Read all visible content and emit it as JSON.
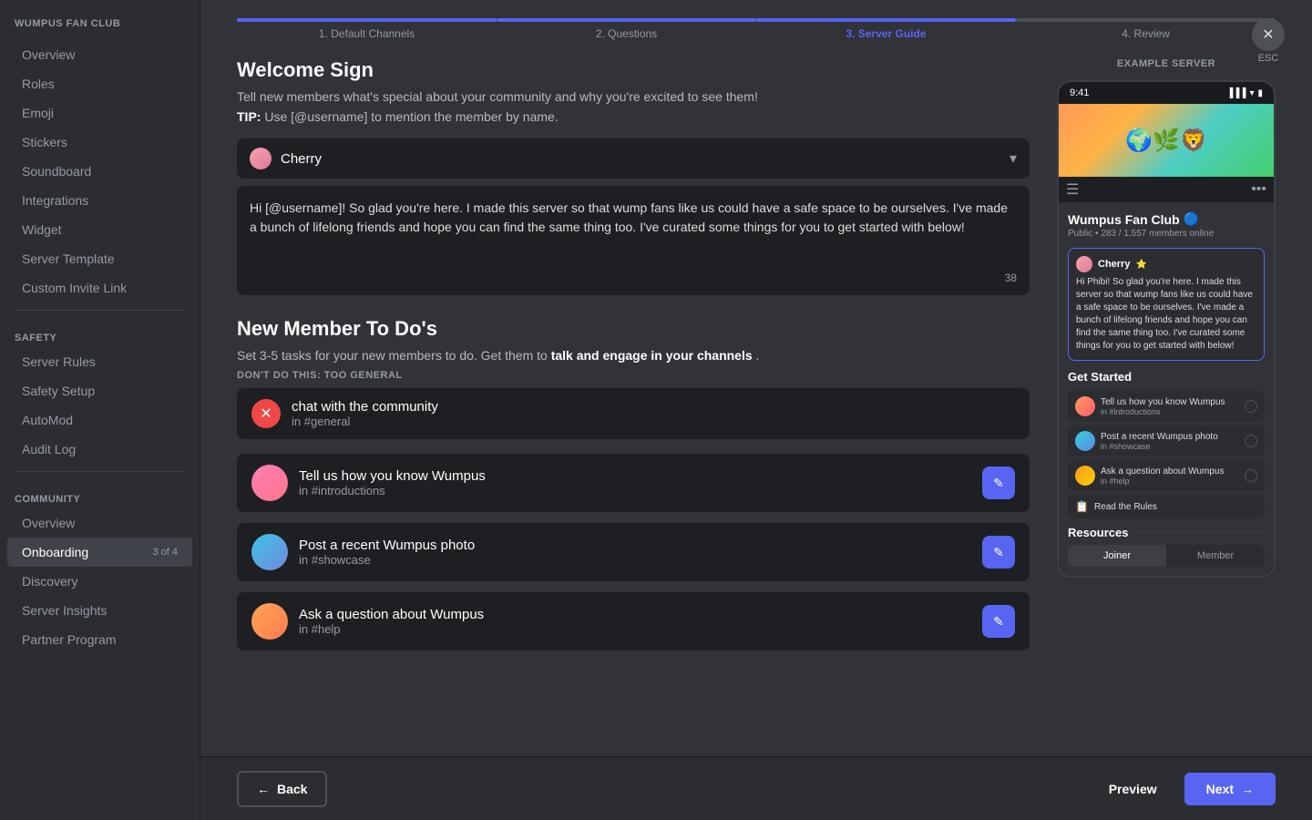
{
  "sidebar": {
    "server_name": "WUMPUS FAN CLUB",
    "items_main": [
      {
        "label": "Overview",
        "id": "overview"
      },
      {
        "label": "Roles",
        "id": "roles"
      },
      {
        "label": "Emoji",
        "id": "emoji"
      },
      {
        "label": "Stickers",
        "id": "stickers"
      },
      {
        "label": "Soundboard",
        "id": "soundboard"
      },
      {
        "label": "Integrations",
        "id": "integrations"
      },
      {
        "label": "Widget",
        "id": "widget"
      },
      {
        "label": "Server Template",
        "id": "server-template"
      },
      {
        "label": "Custom Invite Link",
        "id": "custom-invite"
      }
    ],
    "section_safety": "SAFETY",
    "items_safety": [
      {
        "label": "Server Rules",
        "id": "server-rules"
      },
      {
        "label": "Safety Setup",
        "id": "safety-setup"
      },
      {
        "label": "AutoMod",
        "id": "automod"
      },
      {
        "label": "Audit Log",
        "id": "audit-log"
      }
    ],
    "section_community": "COMMUNITY",
    "items_community": [
      {
        "label": "Overview",
        "id": "community-overview"
      },
      {
        "label": "Onboarding",
        "id": "onboarding",
        "badge": "3 of 4",
        "active": true
      },
      {
        "label": "Discovery",
        "id": "discovery"
      },
      {
        "label": "Server Insights",
        "id": "server-insights"
      },
      {
        "label": "Partner Program",
        "id": "partner-program"
      }
    ]
  },
  "stepper": {
    "steps": [
      {
        "label": "1. Default Channels",
        "state": "completed"
      },
      {
        "label": "2. Questions",
        "state": "completed"
      },
      {
        "label": "3. Server Guide",
        "state": "active"
      },
      {
        "label": "4. Review",
        "state": "inactive"
      }
    ],
    "esc_label": "ESC"
  },
  "welcome_sign": {
    "title": "Welcome Sign",
    "description": "Tell new members what's special about your community and why you're excited to see them!",
    "tip_label": "TIP:",
    "tip_text": "Use [@username] to mention the member by name.",
    "dropdown_name": "Cherry",
    "message_text": "Hi [@username]! So glad you're here. I made this server so that wump fans like us could have a safe space to be ourselves. I've made a bunch of lifelong friends and hope you can find the same thing too. I've curated some things for you to get started with below!",
    "message_count": "38"
  },
  "new_member_todos": {
    "title": "New Member To Do's",
    "description_normal": "Set 3-5 tasks for your new members to do. Get them to ",
    "description_bold": "talk and engage in your channels",
    "description_end": ".",
    "dont_label": "DON'T DO THIS: TOO GENERAL",
    "bad_item": {
      "text": "chat with the community",
      "channel": "in #general"
    },
    "good_items": [
      {
        "text": "Tell us how you know Wumpus",
        "channel": "in #introductions"
      },
      {
        "text": "Post a recent Wumpus photo",
        "channel": "in #showcase"
      },
      {
        "text": "Ask a question about Wumpus",
        "channel": "in #help"
      }
    ]
  },
  "example_server": {
    "label": "EXAMPLE SERVER",
    "server_name": "Wumpus Fan Club",
    "server_meta": "Public  •  283 / 1,557 members online",
    "message_user": "Cherry",
    "message_text": "Hi Phibi! So glad you're here. I made this server so that wump fans like us could have a safe space to be ourselves. I've made a bunch of lifelong friends and hope you can find the same thing too. I've curated some things for you to get started with below!",
    "get_started": "Get Started",
    "tasks": [
      {
        "text": "Tell us how you know Wumpus",
        "channel": "in #introductions"
      },
      {
        "text": "Post a recent Wumpus photo",
        "channel": "in #showcase"
      },
      {
        "text": "Ask a question about Wumpus",
        "channel": "in #help"
      }
    ],
    "read_rules": "Read the Rules",
    "resources_label": "Resources",
    "tabs": [
      {
        "label": "Joiner",
        "active": true
      },
      {
        "label": "Member",
        "active": false
      }
    ]
  },
  "bottom_bar": {
    "back_label": "Back",
    "preview_label": "Preview",
    "next_label": "Next"
  }
}
